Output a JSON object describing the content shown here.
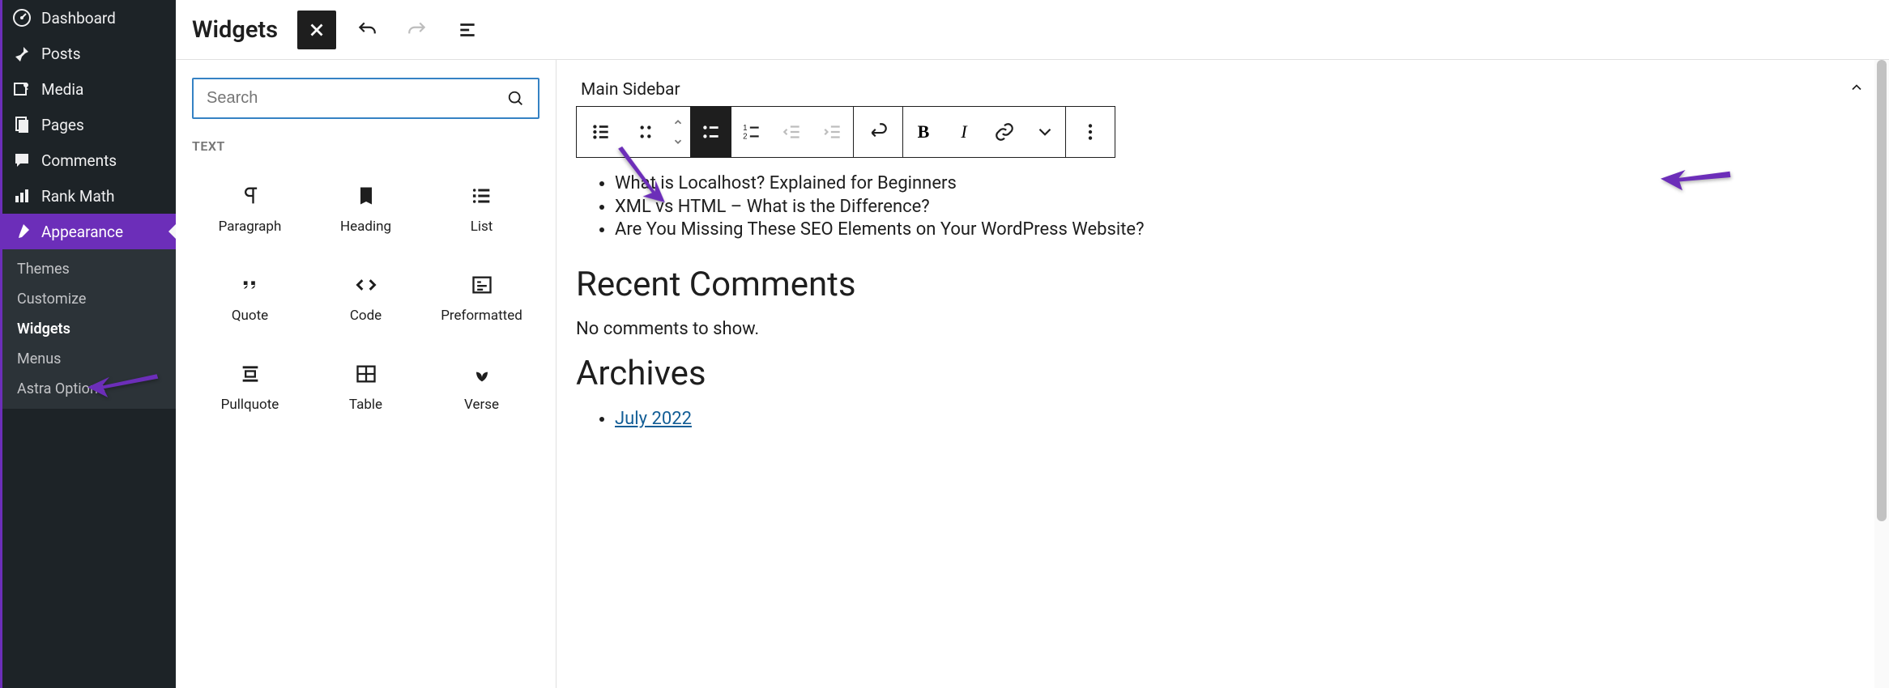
{
  "sidebar": {
    "items": [
      {
        "label": "Dashboard",
        "icon": "dashboard"
      },
      {
        "label": "Posts",
        "icon": "pin"
      },
      {
        "label": "Media",
        "icon": "media"
      },
      {
        "label": "Pages",
        "icon": "pages"
      },
      {
        "label": "Comments",
        "icon": "comment"
      },
      {
        "label": "Rank Math",
        "icon": "chart"
      },
      {
        "label": "Appearance",
        "icon": "brush"
      }
    ],
    "submenu": [
      {
        "label": "Themes"
      },
      {
        "label": "Customize"
      },
      {
        "label": "Widgets"
      },
      {
        "label": "Menus"
      },
      {
        "label": "Astra Options"
      }
    ],
    "active_submenu": "Widgets"
  },
  "header": {
    "title": "Widgets"
  },
  "inserter": {
    "search_placeholder": "Search",
    "section_label": "TEXT",
    "blocks": [
      {
        "label": "Paragraph",
        "icon": "paragraph"
      },
      {
        "label": "Heading",
        "icon": "heading"
      },
      {
        "label": "List",
        "icon": "list"
      },
      {
        "label": "Quote",
        "icon": "quote"
      },
      {
        "label": "Code",
        "icon": "code"
      },
      {
        "label": "Preformatted",
        "icon": "preformatted"
      },
      {
        "label": "Pullquote",
        "icon": "pullquote"
      },
      {
        "label": "Table",
        "icon": "table"
      },
      {
        "label": "Verse",
        "icon": "verse"
      }
    ]
  },
  "canvas": {
    "area_title": "Main Sidebar",
    "list_items": [
      "What is Localhost? Explained for Beginners",
      "XML vs HTML – What is the Difference?",
      "Are You Missing These SEO Elements on Your WordPress Website?"
    ],
    "recent_comments_heading": "Recent Comments",
    "no_comments_text": "No comments to show.",
    "archives_heading": "Archives",
    "archive_items": [
      "July 2022"
    ]
  },
  "colors": {
    "accent": "#6c2eb9",
    "link": "#135e96",
    "focus": "#3582c4"
  }
}
